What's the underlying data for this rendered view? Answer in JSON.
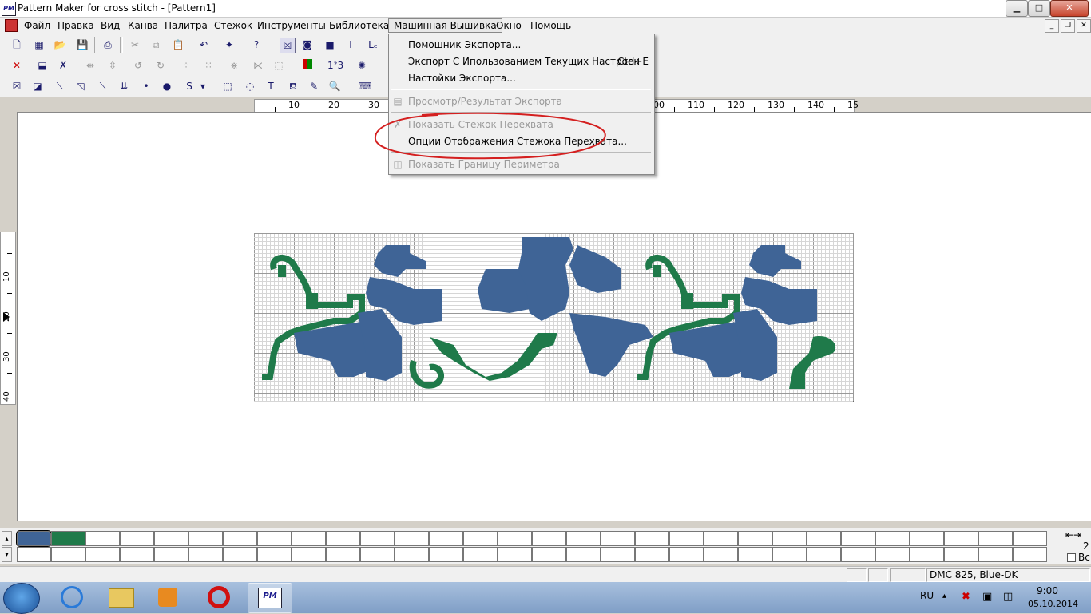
{
  "window": {
    "title": "Pattern Maker for cross stitch - [Pattern1]",
    "app_icon_text": "PM",
    "minimize": "▁",
    "maximize": "□",
    "close": "✕"
  },
  "menubar": {
    "items": [
      "Файл",
      "Правка",
      "Вид",
      "Канва",
      "Палитра",
      "Стежок",
      "Инструменты",
      "Библиотека",
      "Машинная Вышивка",
      "Окно",
      "Помощь"
    ],
    "active": "Машинная Вышивка"
  },
  "dropdown": {
    "items": [
      {
        "label": "Помошник Экспорта...",
        "enabled": true
      },
      {
        "label": "Экспорт С Ипользованием Текущих Настроек",
        "shortcut": "Ctrl+E",
        "enabled": true
      },
      {
        "label": "Настойки Экспорта...",
        "enabled": true
      },
      {
        "label": "Просмотр/Результат Экспорта",
        "enabled": false,
        "icon": "preview-icon"
      },
      {
        "label": "Показать Стежок Перехвата",
        "enabled": false,
        "icon": "jump-stitch-icon"
      },
      {
        "label": "Опции Отображения Стежока Перехвата...",
        "enabled": true
      },
      {
        "label": "Показать Границу Периметра",
        "enabled": false,
        "icon": "perimeter-icon"
      }
    ]
  },
  "ruler": {
    "h_labels": [
      "10",
      "20",
      "30",
      "",
      "",
      "",
      "",
      "",
      "",
      "100",
      "110",
      "120",
      "130",
      "140",
      "15"
    ],
    "v_labels": [
      "10",
      "20",
      "30",
      "40"
    ]
  },
  "palette": {
    "colors": [
      "#3f6496",
      "#1f7a4a"
    ]
  },
  "statusbar": {
    "color_info": "DMC  825, Blue-DK"
  },
  "right_panel": {
    "value": "2",
    "checkbox_label": "Вс"
  },
  "taskbar": {
    "lang": "RU",
    "time": "9:00",
    "date": "05.10.2014"
  },
  "colors": {
    "blue_stitch": "#3f6496",
    "green_stitch": "#1f7a4a",
    "annotation_red": "#d42020"
  }
}
